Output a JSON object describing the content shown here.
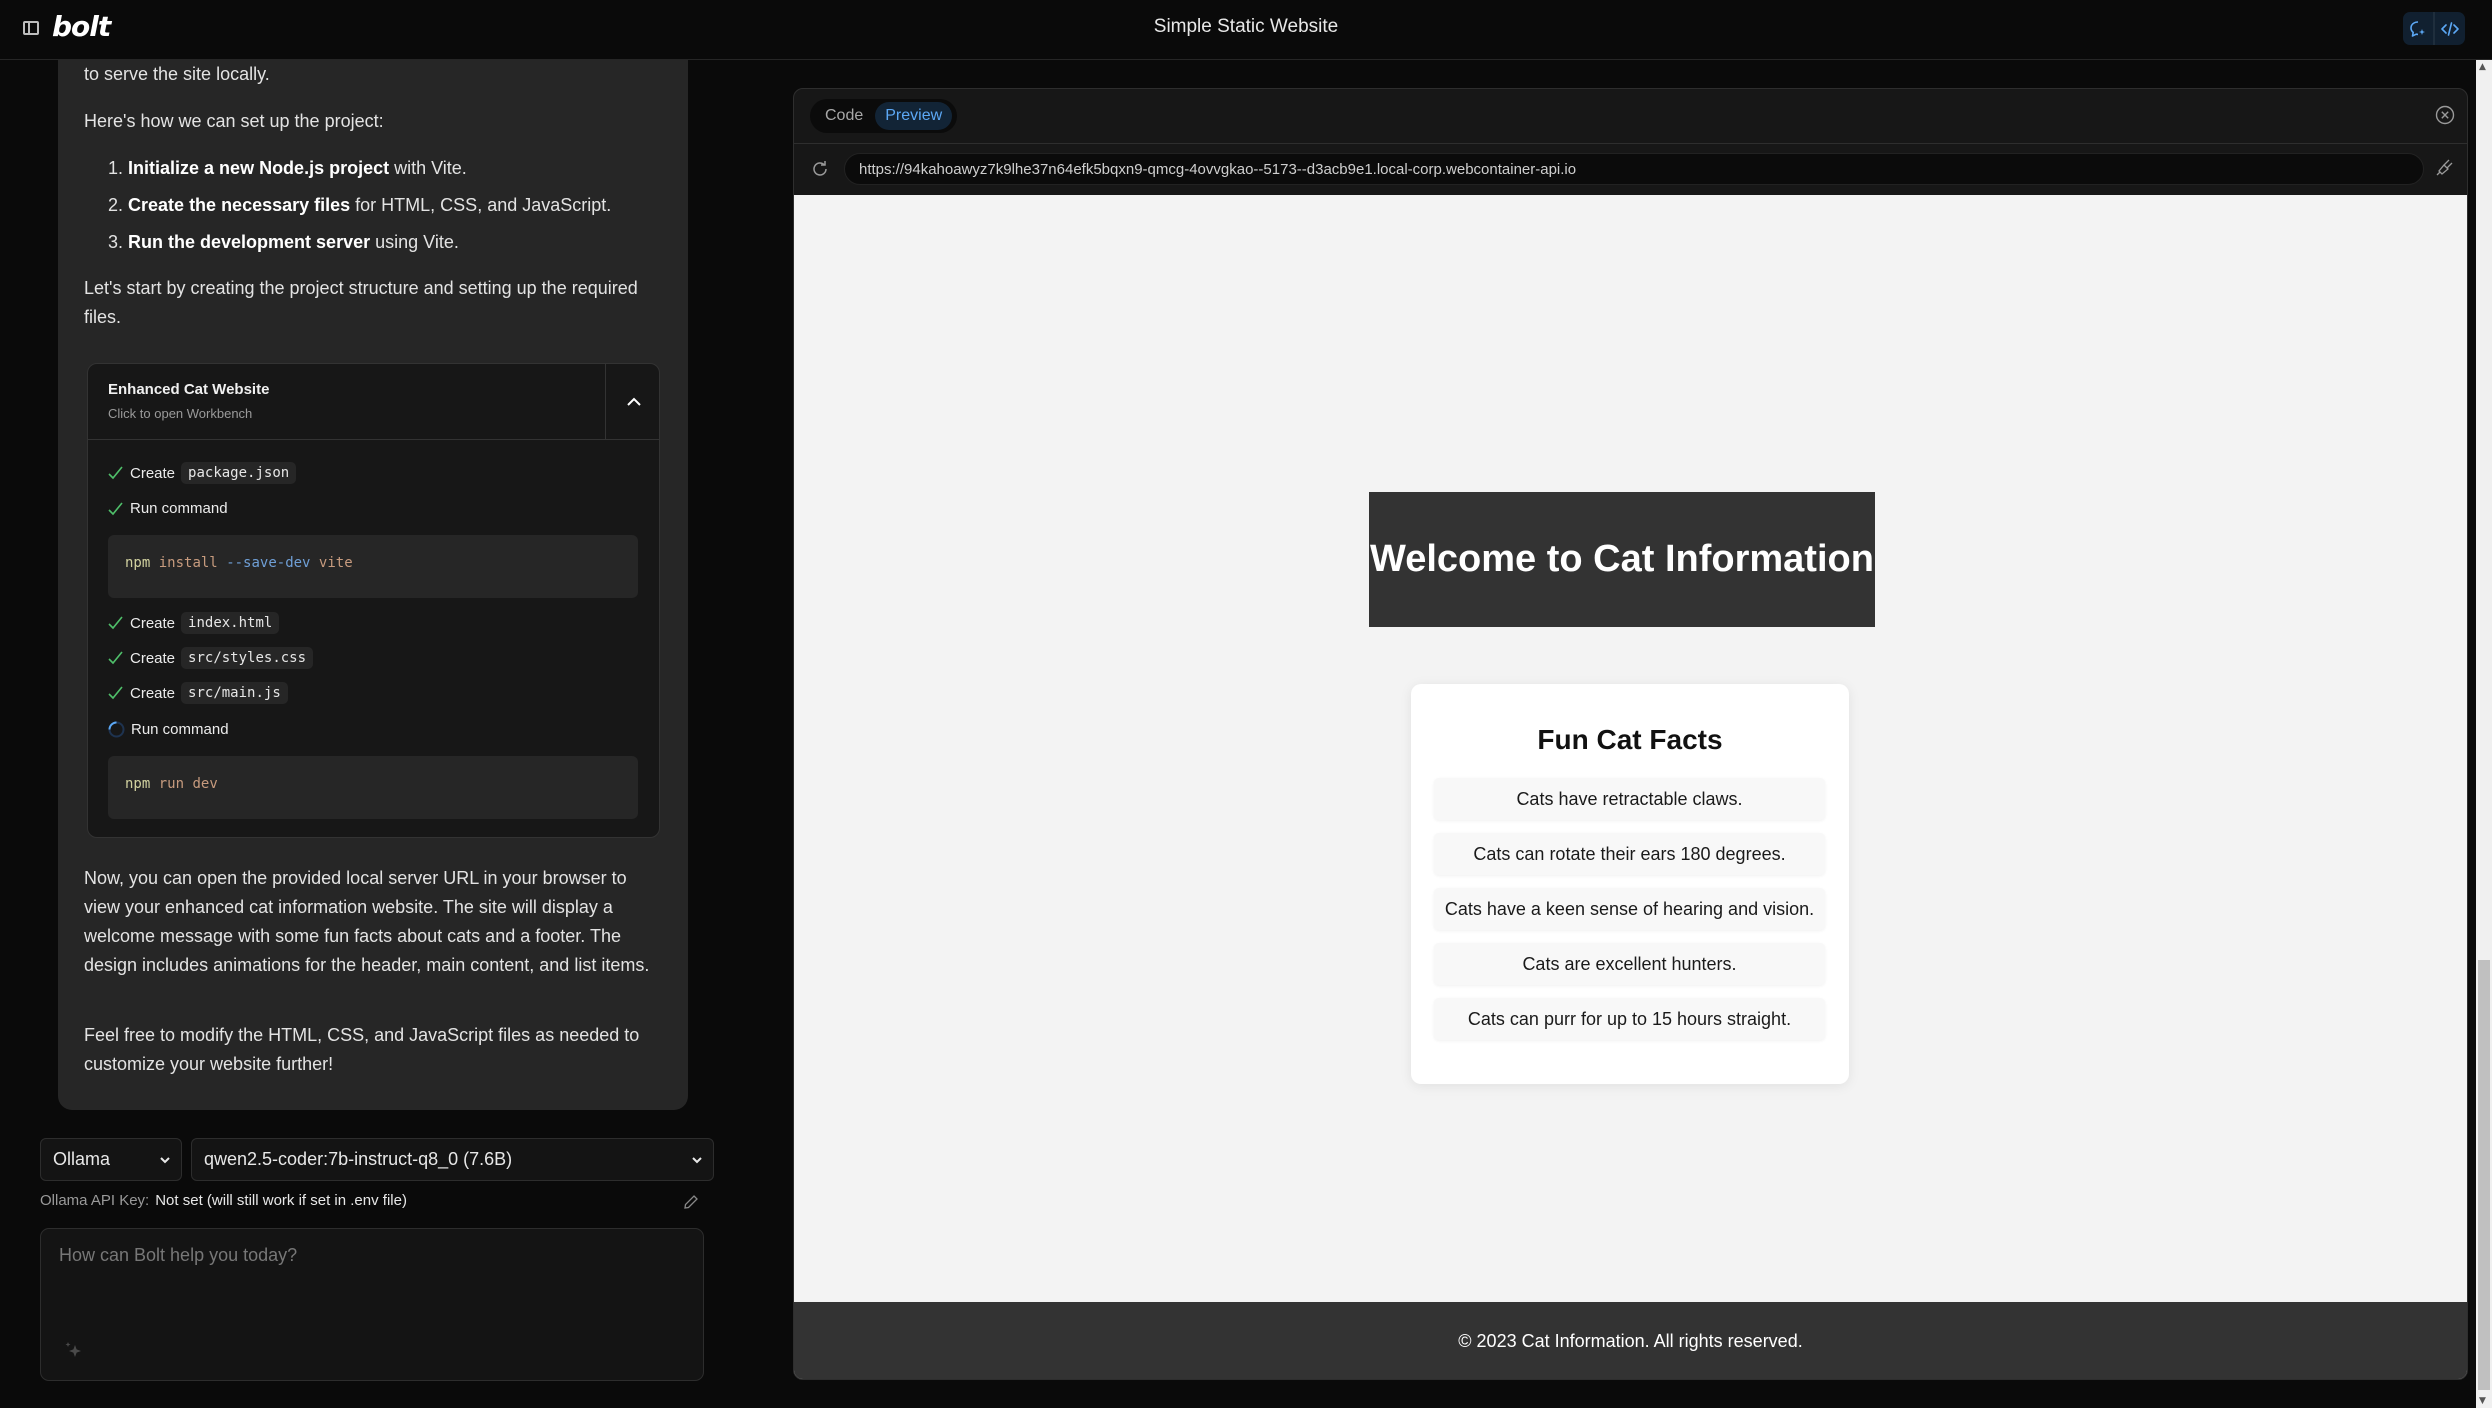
{
  "header": {
    "logo": "bolt",
    "title": "Simple Static Website",
    "sidebar_toggle_icon": "sidebar-toggle-icon",
    "view_toggle": [
      {
        "name": "chat-view",
        "icon": "chat-sparkle-icon",
        "active": true
      },
      {
        "name": "code-view",
        "icon": "code-brackets-icon",
        "active": true
      }
    ]
  },
  "chat": {
    "paragraphs_top": [
      "to serve the site locally.",
      "Here's how we can set up the project:"
    ],
    "steps": [
      {
        "num": "1.",
        "bold": "Initialize a new Node.js project",
        "rest": " with Vite."
      },
      {
        "num": "2.",
        "bold": "Create the necessary files",
        "rest": " for HTML, CSS, and JavaScript."
      },
      {
        "num": "3.",
        "bold": "Run the development server",
        "rest": " using Vite."
      }
    ],
    "paragraph_after_steps": "Let's start by creating the project structure and setting up the required files.",
    "artifact": {
      "title": "Enhanced Cat Website",
      "subtitle": "Click to open Workbench",
      "actions": [
        {
          "status": "done",
          "label": "Create",
          "file": "package.json"
        },
        {
          "status": "done",
          "label": "Run command",
          "command": {
            "bin": "npm",
            "sub": "install",
            "flag": "--save-dev",
            "arg": "vite"
          }
        },
        {
          "status": "done",
          "label": "Create",
          "file": "index.html"
        },
        {
          "status": "done",
          "label": "Create",
          "file": "src/styles.css"
        },
        {
          "status": "done",
          "label": "Create",
          "file": "src/main.js"
        },
        {
          "status": "running",
          "label": "Run command",
          "command": {
            "bin": "npm",
            "sub": "run",
            "flag": "",
            "arg": "dev"
          }
        }
      ]
    },
    "paragraphs_bottom": [
      "Now, you can open the provided local server URL in your browser to view your enhanced cat information website. The site will display a welcome message with some fun facts about cats and a footer. The design includes animations for the header, main content, and list items.",
      "Feel free to modify the HTML, CSS, and JavaScript files as needed to customize your website further!"
    ]
  },
  "model_controls": {
    "provider": "Ollama",
    "model": "qwen2.5-coder:7b-instruct-q8_0 (7.6B)",
    "api_key_label": "Ollama API Key:",
    "api_key_value": "Not set (will still work if set in .env file)"
  },
  "prompt": {
    "placeholder": "How can Bolt help you today?",
    "value": ""
  },
  "workbench": {
    "tabs": [
      {
        "label": "Code",
        "active": false
      },
      {
        "label": "Preview",
        "active": true
      }
    ],
    "url": "https://94kahoawyz7k9lhe37n64efk5bqxn9-qmcg-4ovvgkao--5173--d3acb9e1.local-corp.webcontainer-api.io"
  },
  "site": {
    "header": "Welcome to Cat Information",
    "facts_title": "Fun Cat Facts",
    "facts": [
      "Cats have retractable claws.",
      "Cats can rotate their ears 180 degrees.",
      "Cats have a keen sense of hearing and vision.",
      "Cats are excellent hunters.",
      "Cats can purr for up to 15 hours straight."
    ],
    "footer": "© 2023 Cat Information. All rights reserved."
  },
  "colors": {
    "accent": "#5ca8f5",
    "success": "#4fbf6a",
    "site_dark": "#333333",
    "site_bg": "#f3f3f3"
  }
}
